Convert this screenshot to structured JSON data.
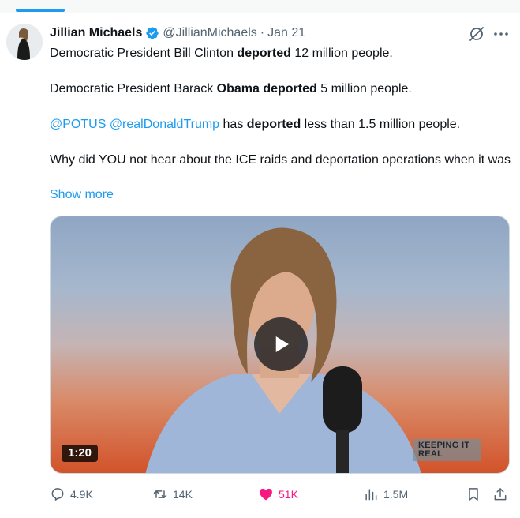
{
  "tweet": {
    "author_name": "Jillian Michaels",
    "handle": "@JillianMichaels",
    "separator": "·",
    "date": "Jan 21",
    "text": {
      "line1_a": "Democratic President Bill Clinton ",
      "line1_b": "deported",
      "line1_c": " 12 million people.",
      "line2_a": "Democratic President Barack ",
      "line2_b": "Obama deported",
      "line2_c": " 5 million people.",
      "line3_mention1": "@POTUS",
      "line3_mention2": "@realDonaldTrump",
      "line3_a": " has ",
      "line3_b": "deported",
      "line3_c": " less than 1.5 million people.",
      "line4": "Why did YOU not hear about the ICE raids and deportation operations when it was"
    },
    "show_more": "Show more",
    "media": {
      "duration": "1:20",
      "watermark_line1": "KEEPING IT",
      "watermark_line2": "REAL"
    },
    "actions": {
      "replies": "4.9K",
      "reposts": "14K",
      "likes": "51K",
      "views": "1.5M"
    }
  },
  "colors": {
    "accent": "#1d9bf0",
    "like": "#f91880",
    "muted": "#536471"
  },
  "icons": [
    "verified-badge-icon",
    "grok-icon",
    "more-icon",
    "reply-icon",
    "repost-icon",
    "heart-icon",
    "views-icon",
    "bookmark-icon",
    "share-icon",
    "play-icon"
  ]
}
